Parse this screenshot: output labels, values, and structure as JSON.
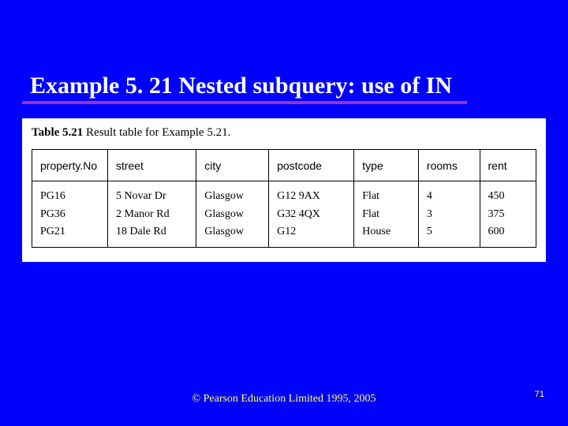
{
  "title": "Example 5. 21  Nested subquery: use of IN",
  "table": {
    "caption_bold": "Table 5.21",
    "caption_rest": "  Result table for Example 5.21.",
    "columns": [
      "property.No",
      "street",
      "city",
      "postcode",
      "type",
      "rooms",
      "rent"
    ],
    "rows": [
      [
        "PG16",
        "5 Novar Dr",
        "Glasgow",
        "G12 9AX",
        "Flat",
        "4",
        "450"
      ],
      [
        "PG36",
        "2 Manor Rd",
        "Glasgow",
        "G32 4QX",
        "Flat",
        "3",
        "375"
      ],
      [
        "PG21",
        "18 Dale Rd",
        "Glasgow",
        "G12",
        "House",
        "5",
        "600"
      ]
    ]
  },
  "footer": "© Pearson Education Limited 1995, 2005",
  "page_number": "71",
  "chart_data": {
    "type": "table",
    "title": "Result table for Example 5.21",
    "columns": [
      "propertyNo",
      "street",
      "city",
      "postcode",
      "type",
      "rooms",
      "rent"
    ],
    "rows": [
      {
        "propertyNo": "PG16",
        "street": "5 Novar Dr",
        "city": "Glasgow",
        "postcode": "G12 9AX",
        "type": "Flat",
        "rooms": 4,
        "rent": 450
      },
      {
        "propertyNo": "PG36",
        "street": "2 Manor Rd",
        "city": "Glasgow",
        "postcode": "G32 4QX",
        "type": "Flat",
        "rooms": 3,
        "rent": 375
      },
      {
        "propertyNo": "PG21",
        "street": "18 Dale Rd",
        "city": "Glasgow",
        "postcode": "G12",
        "type": "House",
        "rooms": 5,
        "rent": 600
      }
    ]
  }
}
